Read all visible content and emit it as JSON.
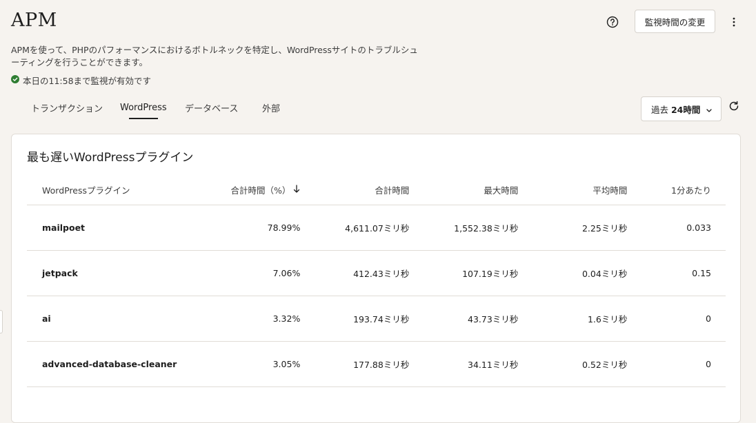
{
  "header": {
    "title": "APM",
    "change_button": "監視時間の変更",
    "description": "APMを使って、PHPのパフォーマンスにおけるボトルネックを特定し、WordPressサイトのトラブルシューティングを行うことができます。",
    "status": "本日の11:58まで監視が有効です"
  },
  "tabs": [
    "トランザクション",
    "WordPress",
    "データベース",
    "外部"
  ],
  "active_tab": "WordPress",
  "range": {
    "prefix": "過去 ",
    "value": "24時間"
  },
  "card": {
    "title": "最も遅いWordPressプラグイン",
    "columns": [
      "WordPressプラグイン",
      "合計時間（%）",
      "合計時間",
      "最大時間",
      "平均時間",
      "1分あたり"
    ],
    "rows": [
      [
        "mailpoet",
        "78.99%",
        "4,611.07ミリ秒",
        "1,552.38ミリ秒",
        "2.25ミリ秒",
        "0.033"
      ],
      [
        "jetpack",
        "7.06%",
        "412.43ミリ秒",
        "107.19ミリ秒",
        "0.04ミリ秒",
        "0.15"
      ],
      [
        "ai",
        "3.32%",
        "193.74ミリ秒",
        "43.73ミリ秒",
        "1.6ミリ秒",
        "0"
      ],
      [
        "advanced-database-cleaner",
        "3.05%",
        "177.88ミリ秒",
        "34.11ミリ秒",
        "0.52ミリ秒",
        "0"
      ]
    ]
  },
  "colors": {
    "background": "#f6f3ef",
    "status_ok": "#2e7d32",
    "text": "#1e1e1e"
  }
}
